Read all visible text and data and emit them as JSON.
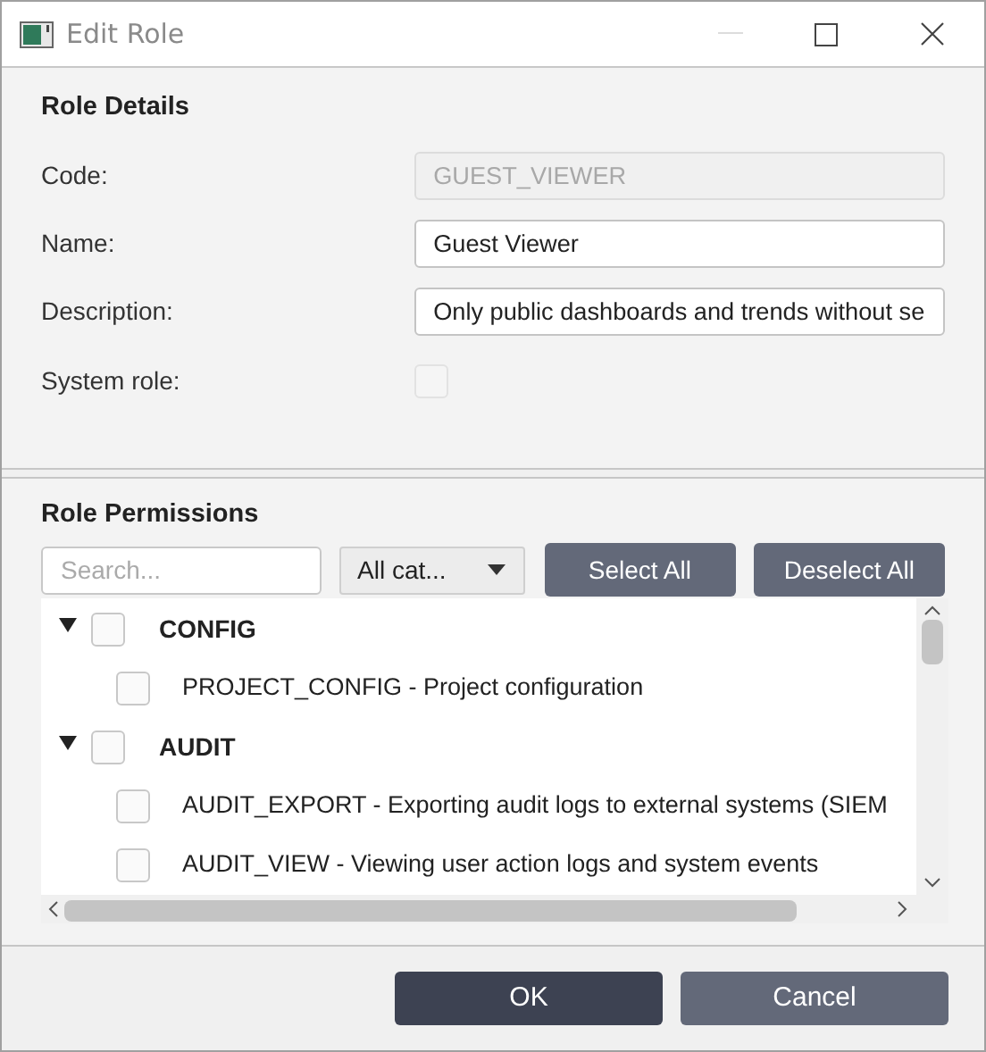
{
  "window": {
    "title": "Edit Role"
  },
  "details": {
    "heading": "Role Details",
    "code": {
      "label": "Code:",
      "value": "GUEST_VIEWER",
      "disabled": true
    },
    "name": {
      "label": "Name:",
      "value": "Guest Viewer"
    },
    "description": {
      "label": "Description:",
      "value": "Only public dashboards and trends without se"
    },
    "system_role": {
      "label": "System role:",
      "checked": false,
      "disabled": true
    }
  },
  "permissions": {
    "heading": "Role Permissions",
    "search": {
      "placeholder": "Search..."
    },
    "category_filter": {
      "value": "All cat..."
    },
    "buttons": [
      "Select All",
      "Deselect All"
    ],
    "tree": [
      {
        "label": "CONFIG",
        "expanded": true,
        "checked": false,
        "children": [
          {
            "label": "PROJECT_CONFIG - Project configuration",
            "checked": false
          }
        ]
      },
      {
        "label": "AUDIT",
        "expanded": true,
        "checked": false,
        "children": [
          {
            "label": "AUDIT_EXPORT - Exporting audit logs to external systems (SIEM",
            "checked": false
          },
          {
            "label": "AUDIT_VIEW - Viewing user action logs and system events",
            "checked": false
          }
        ]
      }
    ]
  },
  "footer": {
    "ok": "OK",
    "cancel": "Cancel"
  }
}
